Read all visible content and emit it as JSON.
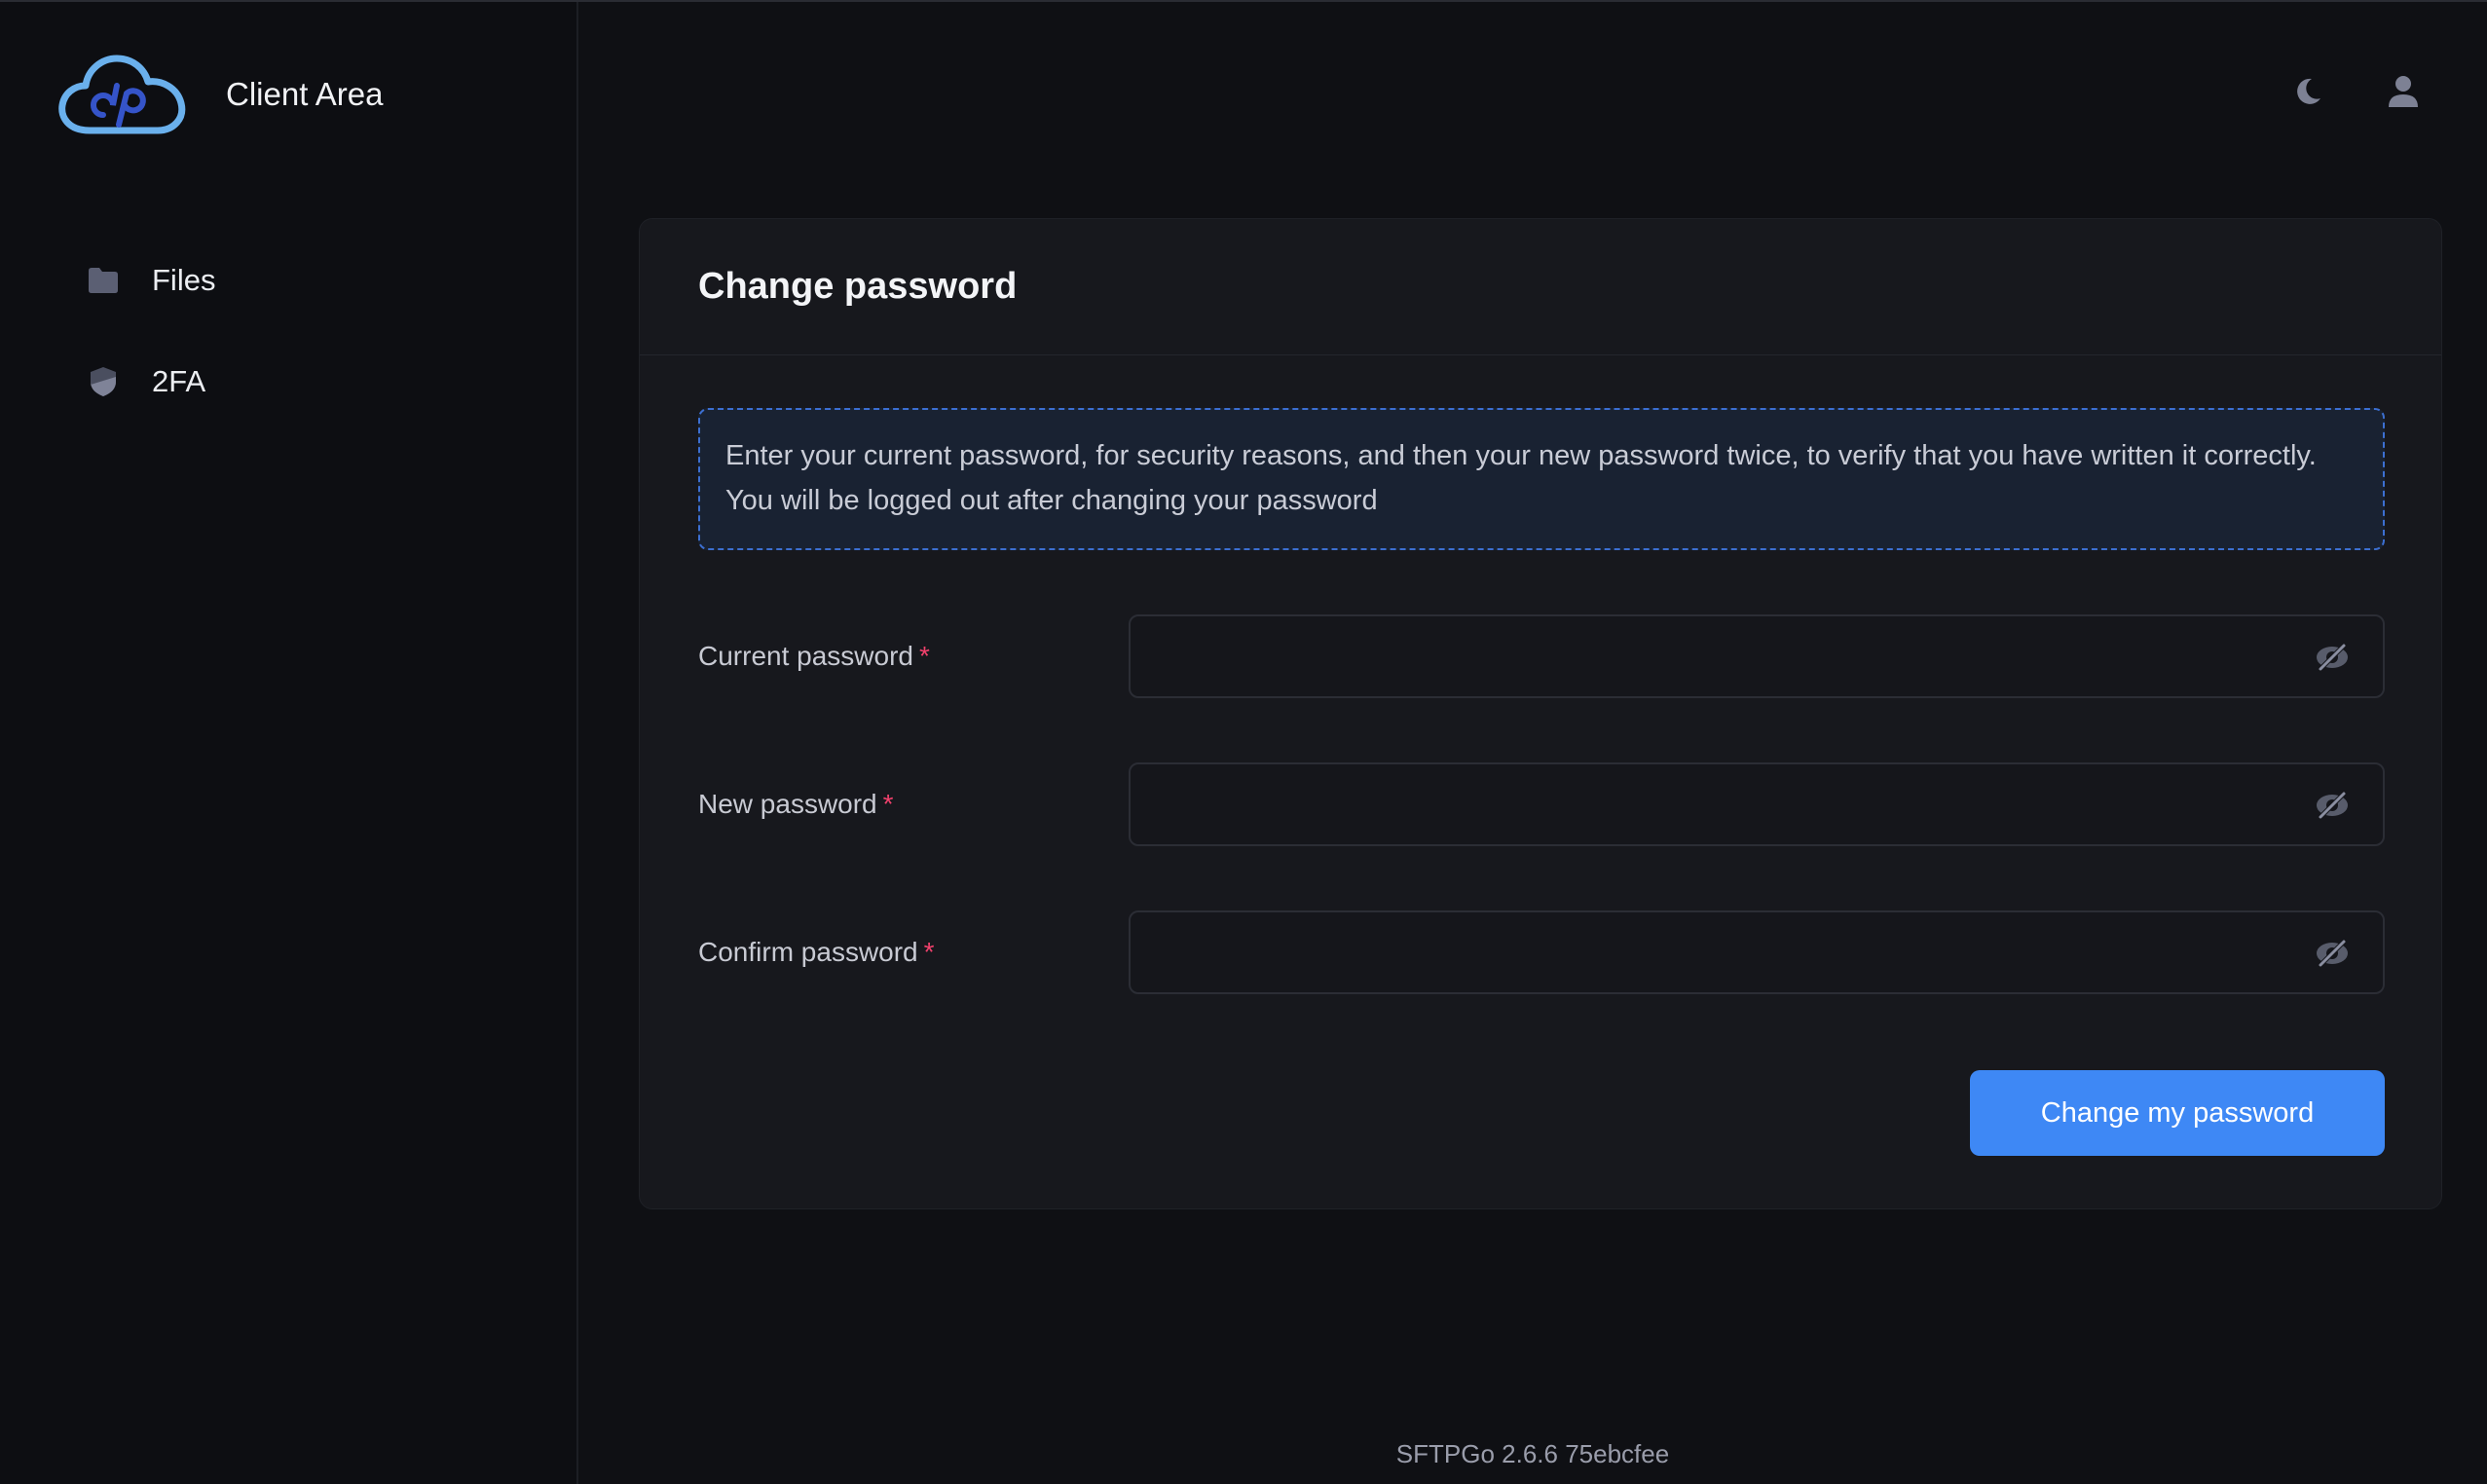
{
  "app": {
    "title": "Client Area"
  },
  "sidebar": {
    "items": [
      {
        "label": "Files",
        "icon": "folder-icon"
      },
      {
        "label": "2FA",
        "icon": "shield-icon"
      }
    ]
  },
  "topbar": {
    "theme_icon": "moon-icon",
    "user_icon": "user-icon"
  },
  "card": {
    "title": "Change password",
    "notice": "Enter your current password, for security reasons, and then your new password twice, to verify that you have written it correctly. You will be logged out after changing your password",
    "fields": [
      {
        "label": "Current password",
        "required_mark": "*",
        "value": ""
      },
      {
        "label": "New password",
        "required_mark": "*",
        "value": ""
      },
      {
        "label": "Confirm password",
        "required_mark": "*",
        "value": ""
      }
    ],
    "submit_label": "Change my password"
  },
  "footer": {
    "version": "SFTPGo 2.6.6 75ebcfee"
  },
  "colors": {
    "accent": "#3e88f5",
    "required": "#f1416c",
    "logo": "#6ab0ec"
  }
}
